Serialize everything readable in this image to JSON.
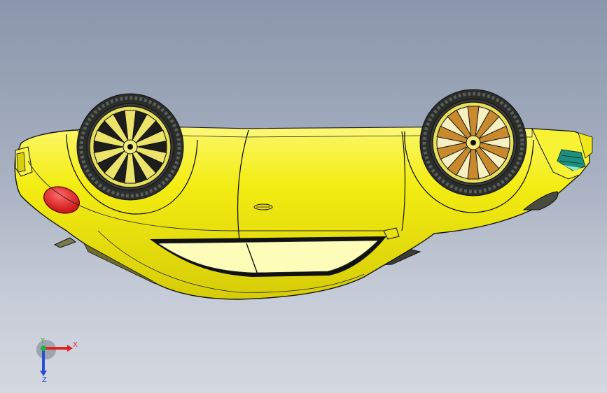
{
  "viewport": {
    "background_top": "#8996ab",
    "background_bottom": "#d4d8e0"
  },
  "model": {
    "body_color": "#f3ec12",
    "body_highlight": "#fbf76a",
    "body_shadow": "#b7ad05",
    "window_color": "#fdfcb8",
    "tail_light_color": "#e11616",
    "vent_color": "#1d8f80",
    "tire_color": "#2b2d2b",
    "rim_color": "#e7df5a",
    "rim_accent_color": "#c88a2c"
  },
  "triad": {
    "x_label": "X",
    "y_label": "Y",
    "z_label": "Z",
    "x_color": "#e02424",
    "y_color": "#22b03a",
    "z_color": "#2a4fd6"
  }
}
